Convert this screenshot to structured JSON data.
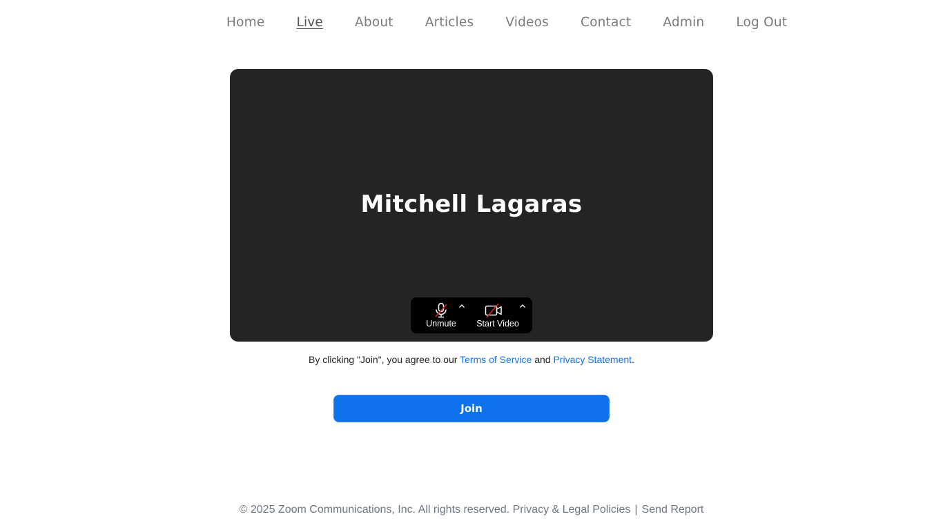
{
  "nav": {
    "items": [
      {
        "label": "Home"
      },
      {
        "label": "Live"
      },
      {
        "label": "About"
      },
      {
        "label": "Articles"
      },
      {
        "label": "Videos"
      },
      {
        "label": "Contact"
      },
      {
        "label": "Admin"
      },
      {
        "label": "Log Out"
      }
    ],
    "active": "Live"
  },
  "preview": {
    "display_name": "Mitchell Lagaras",
    "controls": {
      "audio_label": "Unmute",
      "audio_icon": "mic-muted-icon",
      "video_label": "Start Video",
      "video_icon": "video-off-icon",
      "caret_icon": "chevron-up-icon"
    }
  },
  "agreement": {
    "prefix": "By clicking \"Join\", you agree to our ",
    "terms_link": "Terms of Service",
    "middle": " and ",
    "privacy_link": "Privacy Statement",
    "suffix": "."
  },
  "join": {
    "label": "Join"
  },
  "footer": {
    "copyright": "© 2025 Zoom Communications, Inc. All rights reserved.",
    "privacy_link": "Privacy & Legal Policies",
    "separator": "|",
    "report_link": "Send Report"
  },
  "colors": {
    "accent": "#0e72ed",
    "preview_bg": "#242424",
    "muted_strike": "#e02828",
    "nav_text": "#7a7a7a",
    "footer_text": "#6e7680"
  }
}
